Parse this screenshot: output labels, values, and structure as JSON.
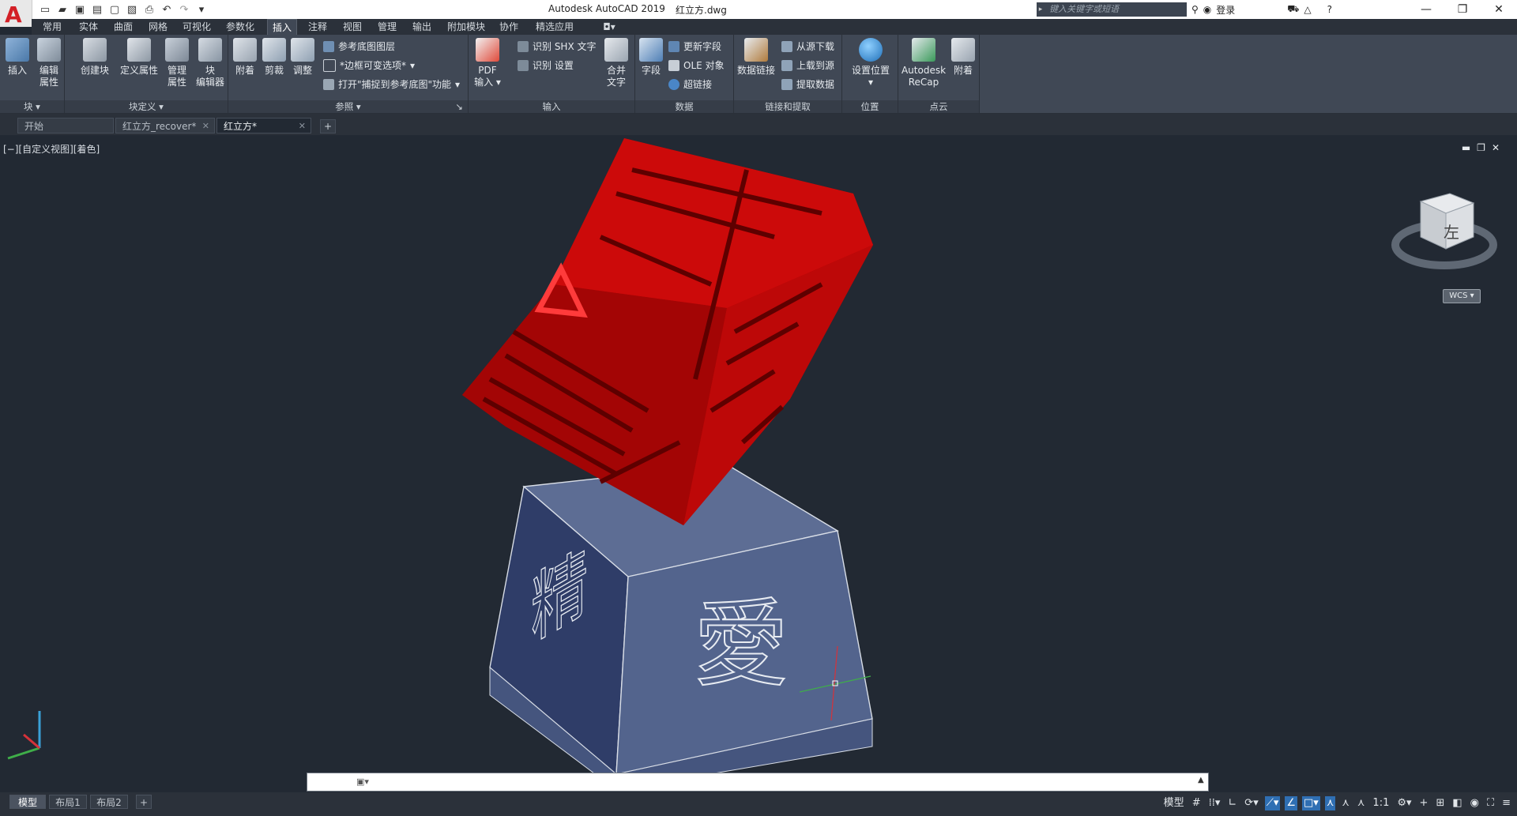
{
  "app": {
    "logo": "A",
    "title": "Autodesk AutoCAD 2019",
    "filename": "红立方.dwg",
    "search_placeholder": "键入关键字或短语",
    "login_label": "登录"
  },
  "menu_tabs": [
    "常用",
    "实体",
    "曲面",
    "网格",
    "可视化",
    "参数化",
    "插入",
    "注释",
    "视图",
    "管理",
    "输出",
    "附加模块",
    "协作",
    "精选应用"
  ],
  "menu_active": "插入",
  "ribbon": {
    "block_panel": {
      "title": "块",
      "insert": "插入",
      "edit_attr_l1": "编辑",
      "edit_attr_l2": "属性"
    },
    "blockdef_panel": {
      "title": "块定义",
      "create": "创建块",
      "define_attr": "定义属性",
      "manage_l1": "管理",
      "manage_l2": "属性",
      "blockeditor_l1": "块",
      "blockeditor_l2": "编辑器"
    },
    "reference_panel": {
      "title": "参照",
      "attach": "附着",
      "clip": "剪裁",
      "adjust": "调整",
      "underlay_layers": "参考底图图层",
      "frames": "*边框可变选项*",
      "snap": "打开\"捕捉到参考底图\"功能"
    },
    "import_panel": {
      "title": "输入",
      "pdf_l1": "PDF",
      "pdf_l2": "输入",
      "recog_shx": "识别 SHX 文字",
      "recog_settings": "识别 设置",
      "combine_l1": "合并",
      "combine_l2": "文字"
    },
    "data_panel": {
      "title": "数据",
      "field": "字段",
      "update_fields": "更新字段",
      "ole": "OLE 对象",
      "hyperlink": "超链接"
    },
    "link_panel": {
      "title": "链接和提取",
      "datalink": "数据链接",
      "download": "从源下载",
      "upload": "上载到源",
      "extract": "提取数据"
    },
    "location_panel": {
      "title": "位置",
      "set_location": "设置位置"
    },
    "pointcloud_panel": {
      "title": "点云",
      "recap_l1": "Autodesk",
      "recap_l2": "ReCap",
      "attach": "附着"
    }
  },
  "doc_tabs": [
    {
      "label": "开始",
      "active": false,
      "closable": false
    },
    {
      "label": "红立方_recover*",
      "active": false,
      "closable": true
    },
    {
      "label": "红立方*",
      "active": true,
      "closable": true
    }
  ],
  "viewport": {
    "label": "[−][自定义视图][着色]",
    "viewcube_face": "左",
    "wcs_label": "WCS",
    "base_char_left": "精",
    "base_char_right": "愛"
  },
  "layout_tabs": [
    {
      "label": "模型",
      "active": true
    },
    {
      "label": "布局1",
      "active": false
    },
    {
      "label": "布局2",
      "active": false
    }
  ],
  "status": {
    "model_label": "模型",
    "scale": "1:1"
  },
  "colors": {
    "cube_red": "#c40808",
    "base_blue": "#4e5e86",
    "bg": "#222933",
    "ribbon": "#404855",
    "accent": "#2f6fb3"
  }
}
